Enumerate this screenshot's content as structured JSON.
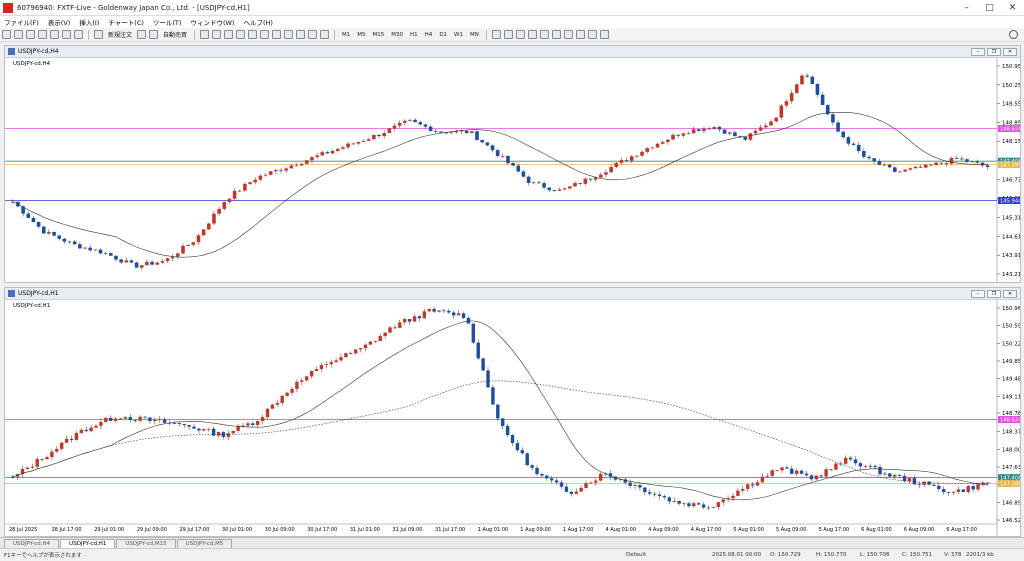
{
  "window": {
    "title": "60796940: FXTF-Live - Goldenway Japan Co., Ltd. - [USDJPY-cd,H1]"
  },
  "menu": [
    "ファイル(F)",
    "表示(V)",
    "挿入(I)",
    "チャート(C)",
    "ツール(T)",
    "ウィンドウ(W)",
    "ヘルプ(H)"
  ],
  "toolbar": {
    "new_order": "新規注文",
    "auto_trading": "自動売買",
    "timeframes": [
      "M1",
      "M5",
      "M15",
      "M30",
      "H1",
      "H4",
      "D1",
      "W1",
      "MN"
    ]
  },
  "colors": {
    "bull": "#c0392b",
    "bear": "#1f4e9c",
    "pink": "#e64ce6",
    "blue": "#2a3bd6",
    "gold": "#e3b84c",
    "teal": "#2d8c8c",
    "orange": "#f0a030"
  },
  "charts": [
    {
      "window_title": "USDJPY-cd,H4",
      "symbol_label": "USDJPY-cd,H4",
      "price_labels": [
        "150.950",
        "150.250",
        "149.550",
        "148.850",
        "148.150",
        "147.430",
        "146.730",
        "146.030",
        "145.310",
        "144.610",
        "143.910",
        "143.210"
      ],
      "hlines": [
        {
          "label": "148.624",
          "color": "#e64ce6"
        },
        {
          "label": "147.408",
          "color": "#2d8c8c"
        },
        {
          "label": "147.285",
          "color": "#e3b84c"
        },
        {
          "label": "145.944",
          "color": "#2a3bd6"
        }
      ]
    },
    {
      "window_title": "USDJPY-cd,H1",
      "symbol_label": "USDJPY-cd,H1",
      "price_labels": [
        "150.960",
        "150.590",
        "150.220",
        "149.850",
        "149.480",
        "149.110",
        "148.760",
        "148.370",
        "148.000",
        "147.630",
        "147.260",
        "146.890",
        "146.520"
      ],
      "hlines": [
        {
          "label": "148.624",
          "color": "#e64ce6"
        },
        {
          "label": "147.408",
          "color": "#2d8c8c"
        },
        {
          "label": "147.285",
          "color": "#e3b84c"
        }
      ],
      "time_labels": [
        "28 Jul 2025",
        "28 Jul 17:00",
        "29 Jul 01:00",
        "29 Jul 09:00",
        "29 Jul 17:00",
        "30 Jul 01:00",
        "30 Jul 09:00",
        "30 Jul 17:00",
        "31 Jul 01:00",
        "31 Jul 09:00",
        "31 Jul 17:00",
        "1 Aug 01:00",
        "1 Aug 09:00",
        "1 Aug 17:00",
        "4 Aug 01:00",
        "4 Aug 09:00",
        "4 Aug 17:00",
        "5 Aug 01:00",
        "5 Aug 09:00",
        "5 Aug 17:00",
        "6 Aug 01:00",
        "6 Aug 09:00",
        "6 Aug 17:00"
      ]
    }
  ],
  "tabs": [
    "USDJPY-cd,H4",
    "USDJPY-cd,H1",
    "USDJPY-cd,M15",
    "USDJPY-cd,M5"
  ],
  "active_tab": 1,
  "status": {
    "help": "F1キーでヘルプが表示されます",
    "profile": "Default",
    "datetime": "2025.08.01 00:00",
    "open": "O: 150.729",
    "high": "H: 150.770",
    "low": "L: 150.708",
    "close": "C: 150.751",
    "volume": "V: 378",
    "traffic": "2201/3 kb"
  }
}
